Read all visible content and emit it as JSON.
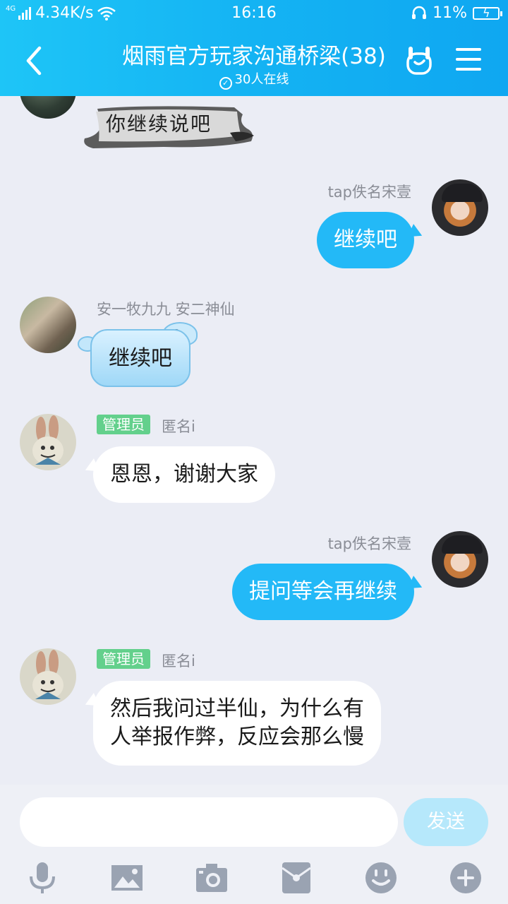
{
  "status_bar": {
    "network": "4G",
    "speed": "4.34K/s",
    "time": "16:16",
    "battery": "11%"
  },
  "header": {
    "title": "烟雨官方玩家沟通桥梁(38)",
    "online": "30人在线",
    "icons": [
      "back-arrow-icon",
      "gesture-icon",
      "menu-icon"
    ]
  },
  "messages": [
    {
      "side": "left",
      "style": "ink",
      "text": "你继续说吧"
    },
    {
      "side": "right",
      "name": "tap佚名宋壹",
      "text": "继续吧"
    },
    {
      "side": "left",
      "name": "安一牧九九  安二神仙",
      "style": "cloud",
      "text": "继续吧"
    },
    {
      "side": "left",
      "role": "管理员",
      "name": "匿名i",
      "text": "恩恩，谢谢大家"
    },
    {
      "side": "right",
      "name": "tap佚名宋壹",
      "text": "提问等会再继续"
    },
    {
      "side": "left",
      "role": "管理员",
      "name": "匿名i",
      "lines": [
        "然后我问过半仙，为什么有",
        "人举报作弊，反应会那么慢"
      ]
    }
  ],
  "input": {
    "placeholder": "",
    "send_label": "发送"
  },
  "toolbar": [
    "microphone-icon",
    "image-icon",
    "camera-icon",
    "red-packet-icon",
    "emoji-icon",
    "plus-icon"
  ],
  "colors": {
    "header": "#14b3f3",
    "bubble_blue": "#23b9f7",
    "admin_tag": "#63d08c",
    "background": "#ebedf5"
  }
}
